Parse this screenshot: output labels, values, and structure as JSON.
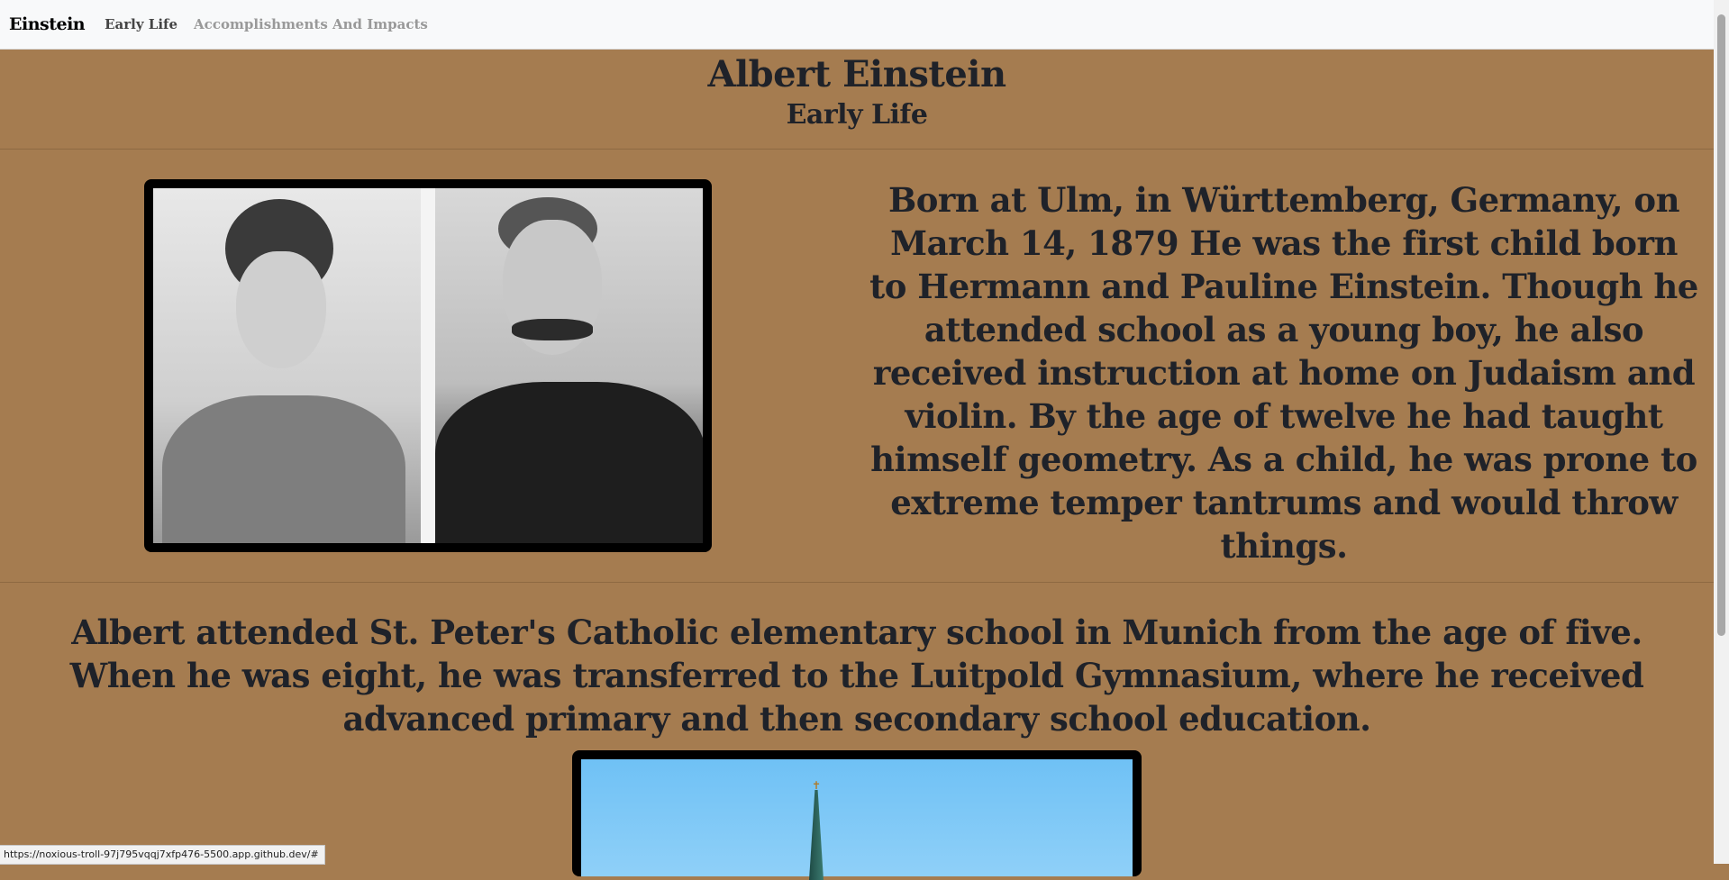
{
  "navbar": {
    "brand": "Einstein",
    "links": [
      "Early Life",
      "Accomplishments And Impacts"
    ]
  },
  "header": {
    "title": "Albert Einstein",
    "subtitle": "Early Life"
  },
  "sections": {
    "intro_text": "Born at Ulm, in Württemberg, Germany, on March 14, 1879 He was the first child born to Hermann and Pauline Einstein. Though he attended school as a young boy, he also received instruction at home on Judaism and violin. By the age of twelve he had taught himself geometry. As a child, he was prone to extreme temper tantrums and would throw things.",
    "school_text": "Albert attended St. Peter's Catholic elementary school in Munich from the age of five. When he was eight, he was transferred to the Luitpold Gymnasium, where he received advanced primary and then secondary school education."
  },
  "status_bar": {
    "url": "https://noxious-troll-97j795vqqj7xfp476-5500.app.github.dev/#"
  },
  "colors": {
    "page_background": "#a57c50",
    "navbar_background": "#f8f9fa",
    "text": "#1f2229"
  }
}
